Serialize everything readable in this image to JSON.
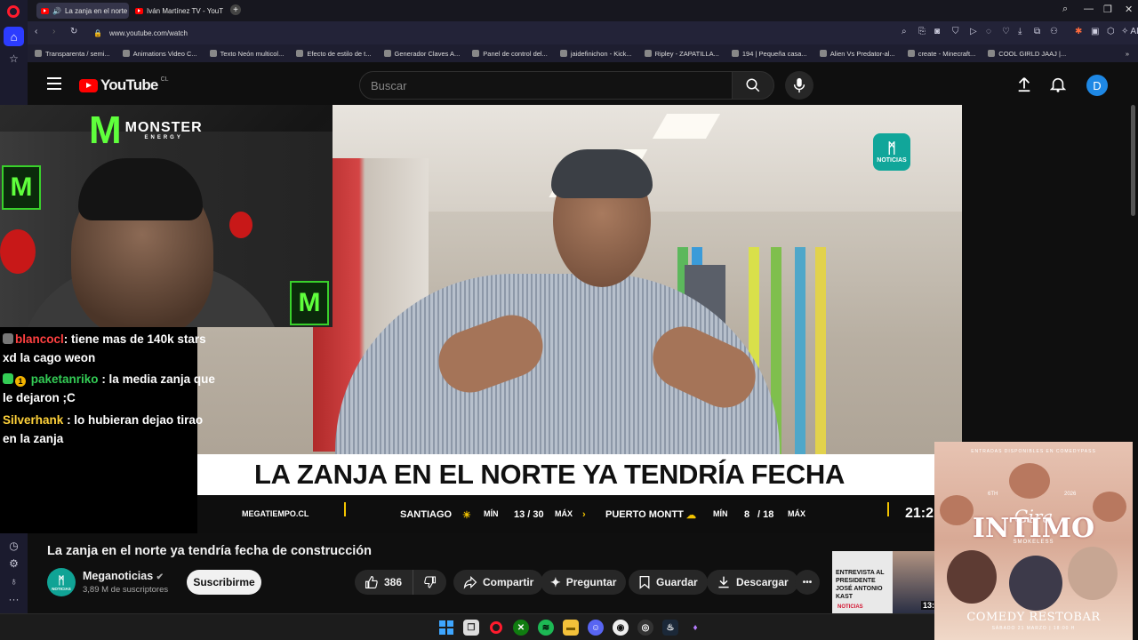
{
  "browser": {
    "tabs": [
      {
        "title": "La zanja en el norte y"
      },
      {
        "title": "Iván Martínez TV - YouTub"
      }
    ],
    "new_tab_icon": "+",
    "url": "www.youtube.com/watch",
    "ai_label": "AI"
  },
  "bookmarks": [
    "Transparenta / semi...",
    "Animations Video C...",
    "Texto Neón multicol...",
    "Efecto de estilo de t...",
    "Generador Claves A...",
    "Panel de control del...",
    "jaidefinichon - Kick...",
    "Ripley - ZAPATILLA...",
    "194 | Pequeña casa...",
    "Alien Vs Predator-al...",
    "create - Minecraft...",
    "COOL GIRLD JAAJ |..."
  ],
  "youtube": {
    "logo_text": "YouTube",
    "country": "CL",
    "search_placeholder": "Buscar",
    "avatar_letter": "D"
  },
  "video": {
    "headline": "LA ZANJA EN EL NORTE YA TENDRÍA FECHA",
    "bug_label": "NOTICIAS",
    "ticker": {
      "site": "MEGATIEMPO.CL",
      "city1": "SANTIAGO",
      "min_label": "MÍN",
      "max_label": "MÁX",
      "city1_temps": "13 / 30",
      "city2": "PUERTO MONTT",
      "city2_min": "8",
      "city2_sep": "/ 18",
      "time": "21:2"
    }
  },
  "stream_overlay": {
    "monster_brand": "MONSTER",
    "monster_sub": "ENERGY",
    "chat": [
      {
        "user": "blancocl",
        "text": ": tiene mas de 140k stars xd la cago weon",
        "user_color": "#ff4040"
      },
      {
        "user": "paketanriko",
        "text": ": la media zanja que le dejaron ;C",
        "user_color": "#33cc55",
        "badge_text": "1"
      },
      {
        "user": "Silverhank",
        "text": ": lo hubieran dejao tirao en la zanja",
        "user_color": "#ffd23a"
      }
    ]
  },
  "watch": {
    "title": "La zanja en el norte ya tendría fecha de construcción",
    "channel_name": "Meganoticias",
    "subscribers": "3,89 M de suscriptores",
    "subscribe_label": "Suscribirme",
    "likes": "386",
    "share_label": "Compartir",
    "ask_label": "Preguntar",
    "save_label": "Guardar",
    "download_label": "Descargar",
    "more_label": "•••",
    "channel_avatar_text": "NOTICIAS"
  },
  "recommendation": {
    "text": "ENTREVISTA AL PRESIDENTE JOSÉ ANTONIO KAST",
    "brand": "NOTICIAS",
    "duration": "13:"
  },
  "comedy_ad": {
    "top_text": "ENTRADAS DISPONIBLES EN COMEDYPASS",
    "gira": "Gira",
    "intimo": "INTIMO",
    "smokeless": "SMOKELESS",
    "restobar": "COMEDY RESTOBAR",
    "date": "SÁBADO 21 MARZO | 18:00 H",
    "years": "2026",
    "sixth": "6TH"
  },
  "colors": {
    "accent_red": "#ff0000",
    "meganoticias_teal": "#10a395",
    "opera_red": "#ff1b2d",
    "ticker_yellow": "#f2c300"
  }
}
